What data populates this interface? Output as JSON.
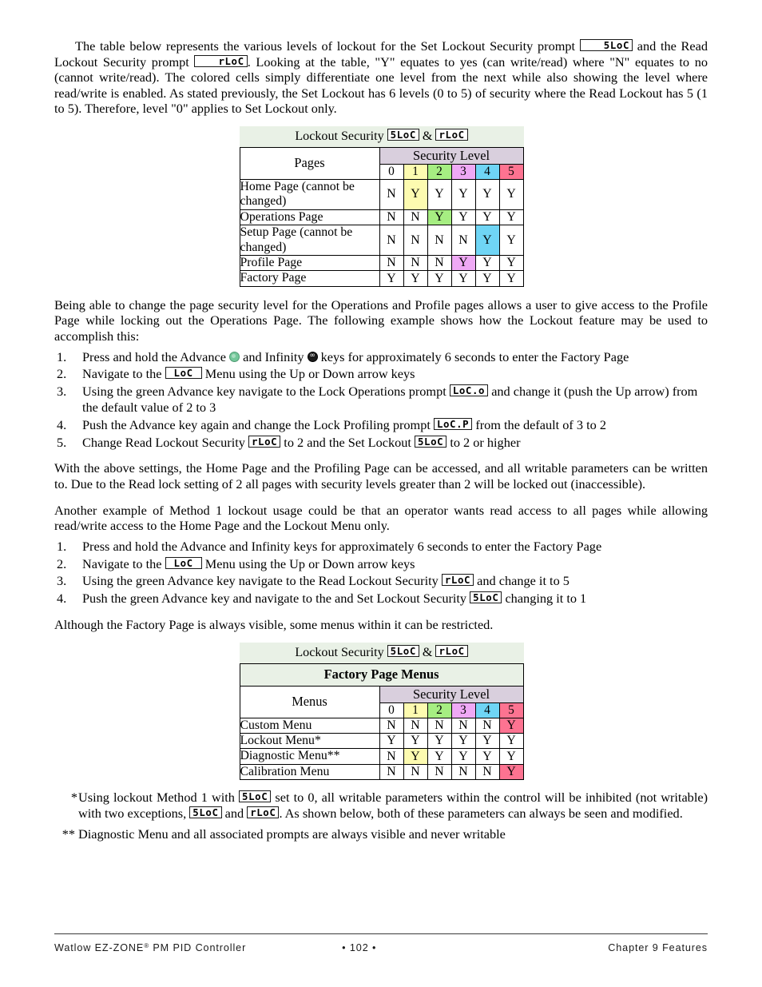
{
  "intro": {
    "paragraph_parts": [
      "The table below represents the various levels of lockout for the Set Lockout Security prompt ",
      " and the Read Lockout Security prompt ",
      ". Looking at the table, \"Y\" equates to yes (can write/read) where \"N\" equates to no (cannot write/read). The colored cells simply differentiate one level from the next while also showing the level where read/write is enabled. As stated previously, the Set Lockout has 6 levels (0 to 5) of security where the Read Lockout has 5 (1 to 5). Therefore, level \"0\" applies to Set Lockout only."
    ]
  },
  "prompts": {
    "set_lockout": "5LoC",
    "read_lockout": "rLoC",
    "lockout_menu": "LoC",
    "lock_operations": "LoC.o",
    "lock_profiling": "LoC.P"
  },
  "table1": {
    "title_prefix": "Lockout Security ",
    "title_amp": " & ",
    "row_header_label": "Pages",
    "security_level_label": "Security Level",
    "levels": [
      "0",
      "1",
      "2",
      "3",
      "4",
      "5"
    ],
    "level_colors": [
      "#ffffff",
      "#fdfbb0",
      "#a6ee82",
      "#efa9f5",
      "#6fd5f5",
      "#fd7391"
    ],
    "rows": [
      {
        "label": "Home Page (cannot be changed)",
        "values": [
          "N",
          "Y",
          "Y",
          "Y",
          "Y",
          "Y"
        ],
        "highlight_index": 1
      },
      {
        "label": "Operations Page",
        "values": [
          "N",
          "N",
          "Y",
          "Y",
          "Y",
          "Y"
        ],
        "highlight_index": 2
      },
      {
        "label": "Setup Page (cannot be changed)",
        "values": [
          "N",
          "N",
          "N",
          "N",
          "Y",
          "Y"
        ],
        "highlight_index": 4
      },
      {
        "label": "Profile Page",
        "values": [
          "N",
          "N",
          "N",
          "Y",
          "Y",
          "Y"
        ],
        "highlight_index": 3
      },
      {
        "label": "Factory Page",
        "values": [
          "Y",
          "Y",
          "Y",
          "Y",
          "Y",
          "Y"
        ],
        "highlight_index": -1
      }
    ]
  },
  "mid_paragraph": "Being able to change the page security level for the Operations and Profile pages allows a user to give access to the Profile Page while locking out the Operations Page.  The following example shows how the Lockout feature may be used to accomplish this:",
  "steps_method1": [
    {
      "parts": [
        "Press and hold the Advance ",
        " and Infinity ",
        " keys for approximately 6 seconds to enter the Factory Page"
      ],
      "icons": [
        "advance-key-icon",
        "infinity-key-icon"
      ]
    },
    {
      "parts": [
        "Navigate to the ",
        " Menu using the Up or Down arrow keys"
      ],
      "lcd": [
        "LoC"
      ]
    },
    {
      "parts": [
        "Using the green Advance key navigate to the Lock Operations prompt ",
        " and change it (push the Up arrow) from the default value of 2 to 3"
      ],
      "lcd": [
        "LoC.o"
      ]
    },
    {
      "parts": [
        "Push the Advance key again and change the Lock Profiling prompt ",
        " from the default of 3 to 2"
      ],
      "lcd": [
        "LoC.P"
      ]
    },
    {
      "parts": [
        "Change Read Lockout Security ",
        " to 2 and the Set Lockout ",
        " to 2 or higher"
      ],
      "lcd": [
        "rLoC",
        "5LoC"
      ]
    }
  ],
  "after_steps_paragraph": "With the above settings, the Home Page and the Profiling Page can be accessed, and all writable parameters can be written to. Due to the Read lock setting of 2 all pages with security levels greater than 2 will be locked out (inaccessible).",
  "second_example_paragraph": "Another example of Method 1 lockout usage could be that an operator wants read access to all pages while allowing read/write access to the Home Page and the Lockout Menu only.",
  "steps_method2": [
    {
      "parts": [
        "Press and hold the Advance and Infinity keys for approximately 6 seconds to enter the Factory Page"
      ]
    },
    {
      "parts": [
        "Navigate to the ",
        " Menu using the Up or Down arrow keys"
      ],
      "lcd": [
        "LoC"
      ]
    },
    {
      "parts": [
        "Using the green Advance key navigate to the Read Lockout Security ",
        " and change it to 5"
      ],
      "lcd": [
        "rLoC"
      ]
    },
    {
      "parts": [
        "Push the green Advance key and navigate to the and Set Lockout Security ",
        " changing it to 1"
      ],
      "lcd": [
        "5LoC"
      ]
    }
  ],
  "factory_note": "Although the Factory Page is always visible, some menus within it can be restricted.",
  "table2": {
    "title_prefix": "Lockout Security ",
    "title_amp": " & ",
    "subtitle": "Factory Page Menus",
    "row_header_label": "Menus",
    "security_level_label": "Security Level",
    "levels": [
      "0",
      "1",
      "2",
      "3",
      "4",
      "5"
    ],
    "level_colors": [
      "#ffffff",
      "#fdfbb0",
      "#a6ee82",
      "#efa9f5",
      "#6fd5f5",
      "#fd7391"
    ],
    "rows": [
      {
        "label": "Custom Menu",
        "values": [
          "N",
          "N",
          "N",
          "N",
          "N",
          "Y"
        ],
        "highlight_index": 5
      },
      {
        "label": "Lockout Menu*",
        "values": [
          "Y",
          "Y",
          "Y",
          "Y",
          "Y",
          "Y"
        ],
        "highlight_index": -1
      },
      {
        "label": "Diagnostic Menu**",
        "values": [
          "N",
          "Y",
          "Y",
          "Y",
          "Y",
          "Y"
        ],
        "highlight_index": 1
      },
      {
        "label": "Calibration Menu",
        "values": [
          "N",
          "N",
          "N",
          "N",
          "N",
          "Y"
        ],
        "highlight_index": 5
      }
    ]
  },
  "footnotes": [
    {
      "marker": "*",
      "parts": [
        "Using lockout Method 1 with ",
        " set to 0, all writable parameters within the control will be inhibited (not writable) with two exceptions, ",
        " and ",
        ". As shown below, both of these parameters can always be seen and modified."
      ],
      "lcd": [
        "5LoC",
        "5LoC",
        "rLoC"
      ]
    },
    {
      "marker": "**",
      "parts": [
        "Diagnostic Menu and all associated prompts are always visible and never writable"
      ],
      "lcd": []
    }
  ],
  "footer": {
    "left_pre": "Watlow EZ-ZONE",
    "left_sup": "®",
    "left_post": " PM PID Controller",
    "center": "•  102  •",
    "right": "Chapter 9 Features"
  }
}
